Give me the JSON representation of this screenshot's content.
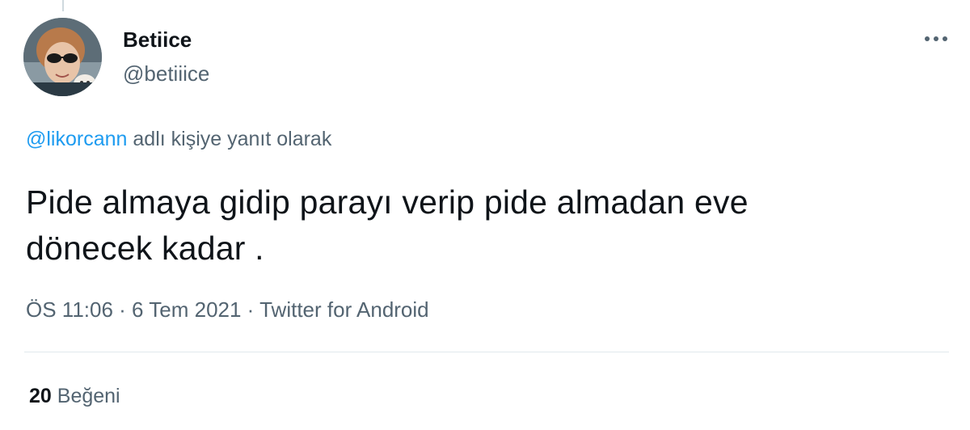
{
  "tweet": {
    "author": {
      "display_name": "Betiice",
      "handle": "@betiiice",
      "avatar_icon": "profile-photo"
    },
    "more_icon": "more-horizontal-icon",
    "reply_context": {
      "mention": "@likorcann",
      "suffix": " adlı kişiye yanıt olarak"
    },
    "text_line1": "Pide almaya gidip parayı verip pide almadan eve",
    "text_line2": "dönecek kadar .",
    "meta": {
      "time": "ÖS 11:06",
      "separator": " · ",
      "date": "6 Tem 2021",
      "source": "Twitter for Android"
    },
    "stats": {
      "likes_count": "20",
      "likes_label": "Beğeni"
    }
  },
  "colors": {
    "link": "#1d9bf0",
    "secondary_text": "#536471",
    "primary_text": "#0f1419",
    "divider": "#e1e8ed"
  }
}
